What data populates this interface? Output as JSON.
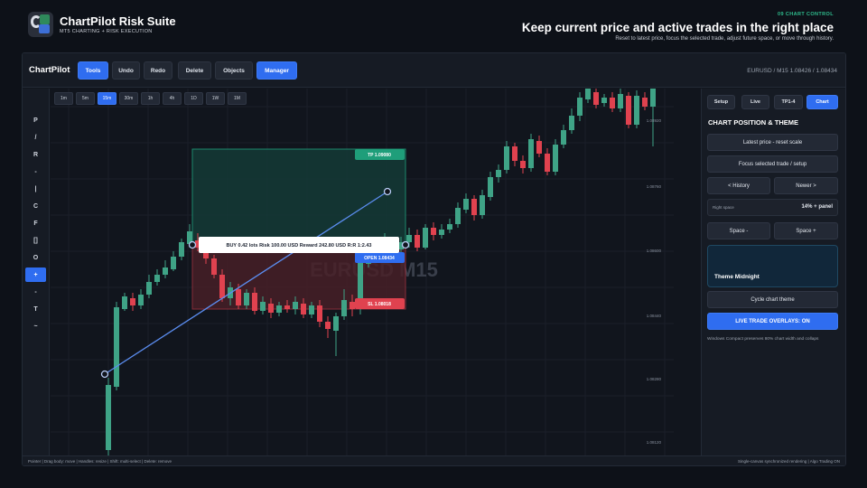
{
  "header": {
    "app_title": "ChartPilot Risk Suite",
    "app_subtitle": "MT5 CHARTING + RISK EXECUTION",
    "step": "09  CHART CONTROL",
    "headline": "Keep current price and active trades in the right place",
    "subline": "Reset to latest price, focus the selected trade, adjust future space, or move through history."
  },
  "toolbar": {
    "brand": "ChartPilot",
    "buttons": [
      "Tools",
      "Undo",
      "Redo",
      "Delete",
      "Objects",
      "Manager"
    ],
    "pair_info": "EURUSD / M15    1.08426 / 1.08434"
  },
  "left_tools": [
    "P",
    "/",
    "R",
    "-",
    "|",
    "C",
    "F",
    "[]",
    "O",
    "+",
    "-",
    "T",
    "~"
  ],
  "timeframes": [
    "1m",
    "5m",
    "15m",
    "30m",
    "1h",
    "4h",
    "1D",
    "1W",
    "1M"
  ],
  "chart": {
    "watermark": "EURUSD  M15",
    "price_labels": [
      "1.08920",
      "1.08760",
      "1.08600",
      "1.08440",
      "1.08280",
      "1.08120"
    ],
    "tp_label": "TP 1.09080",
    "open_label": "OPEN 1.08434",
    "sl_label": "SL 1.08018",
    "trade_info": "BUY 0.42 lots   Risk 100.00 USD   Reward 242.80 USD   R:R 1:2.43"
  },
  "panel": {
    "tabs": [
      "Setup",
      "Live",
      "TP1-4",
      "Chart"
    ],
    "title": "CHART POSITION & THEME",
    "latest_price": "Latest price - reset scale",
    "focus": "Focus selected trade / setup",
    "history": "< History",
    "newer": "Newer >",
    "right_space_label": "Right space",
    "right_space_value": "14% + panel",
    "space_minus": "Space -",
    "space_plus": "Space +",
    "theme_name": "Theme  Midnight",
    "cycle_theme": "Cycle chart theme",
    "live_overlays": "LIVE TRADE OVERLAYS: ON",
    "note": "Windows Compact preserves 80% chart width and collaps"
  },
  "status": {
    "left": "Pointer  |  Drag body: move  |  Handles: resize  |  Shift: multi-select  |  Delete: remove",
    "right": "Single-canvas synchronized rendering  |  Algo Trading ON"
  },
  "colors": {
    "accent": "#2f6df0",
    "up": "#3fa386",
    "down": "#e0424f",
    "tp": "#1f9e7a",
    "sl": "#e0424f"
  }
}
